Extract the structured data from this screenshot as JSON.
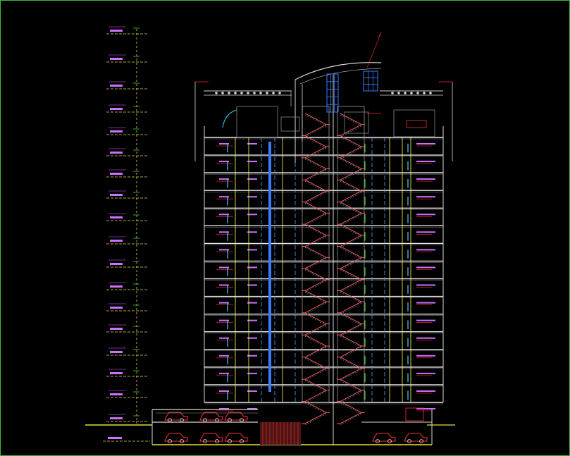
{
  "drawing": {
    "type": "CAD building section elevation",
    "floors_above_ground": 15,
    "basement_levels": 1,
    "stair_cores": 2,
    "parked_cars_shown": 8,
    "colors": {
      "background": "#000000",
      "frame": "#3fb83f",
      "outline": "#d8d8d8",
      "slab": "#e8e8e8",
      "stair": "#ff5a5a",
      "stair_alt": "#4fd0ff",
      "glazing": "#3a7bff",
      "dimension": "#e0e040",
      "level_marker": "#d070ff",
      "column": "#ffff60",
      "annotation": "#ff3030",
      "dash_blue": "#5aa0ff"
    }
  }
}
